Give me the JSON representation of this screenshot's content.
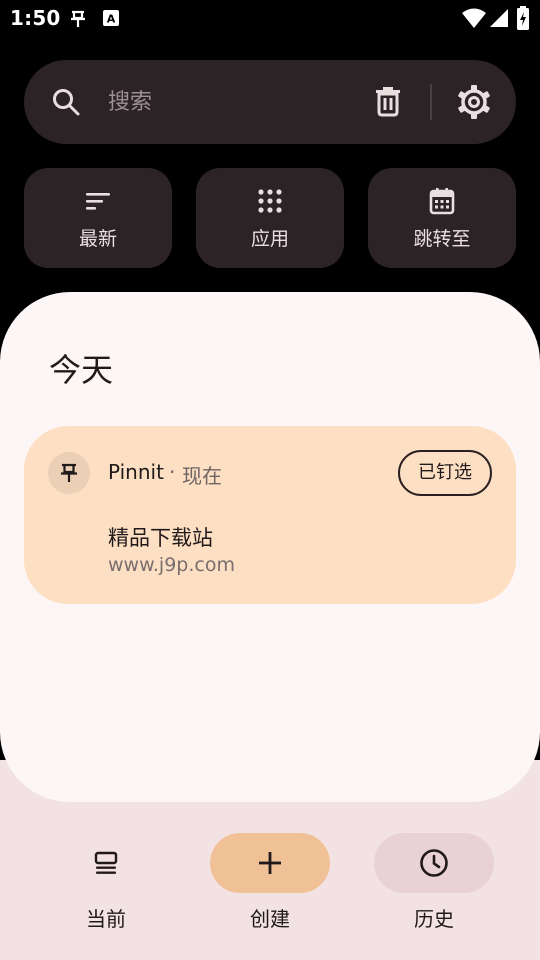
{
  "status_bar": {
    "time": "1:50",
    "notification_letter": "A"
  },
  "search": {
    "placeholder": "搜索"
  },
  "quick_actions": [
    {
      "label": "最新",
      "icon": "sort-lines-icon"
    },
    {
      "label": "应用",
      "icon": "apps-grid-icon"
    },
    {
      "label": "跳转至",
      "icon": "calendar-icon"
    }
  ],
  "sheet": {
    "title": "今天"
  },
  "notification": {
    "app_name": "Pinnit",
    "separator": "·",
    "time": "现在",
    "pin_button_label": "已钉选",
    "title": "精品下载站",
    "text": "www.j9p.com"
  },
  "bottom_nav": {
    "items": [
      {
        "label": "当前",
        "icon": "stack-icon"
      },
      {
        "label": "创建",
        "icon": "plus-icon"
      },
      {
        "label": "历史",
        "icon": "clock-icon"
      }
    ]
  },
  "colors": {
    "background": "#000000",
    "surface_dark": "#2b2325",
    "sheet": "#fdf6f6",
    "card": "#fde0c4",
    "create_accent": "#f0c197",
    "nav_background": "#f3e2e4"
  }
}
